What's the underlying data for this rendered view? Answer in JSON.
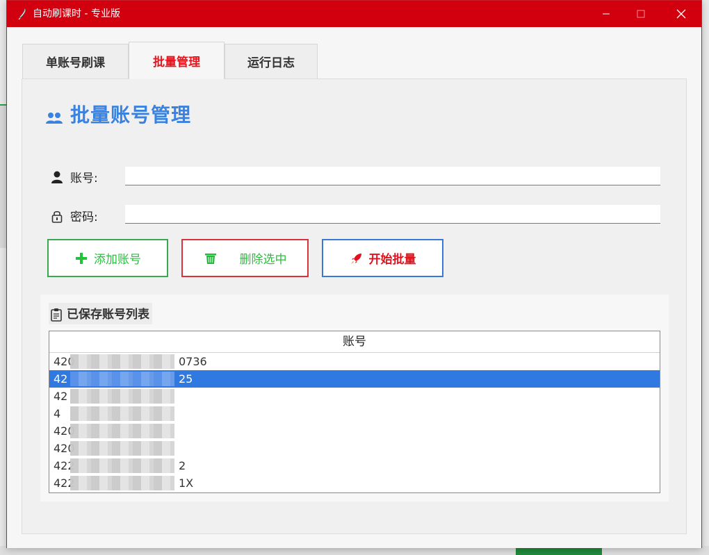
{
  "window": {
    "title": "自动刷课时 - 专业版"
  },
  "tabs": [
    {
      "label": "单账号刷课",
      "active": false
    },
    {
      "label": "批量管理",
      "active": true
    },
    {
      "label": "运行日志",
      "active": false
    }
  ],
  "section": {
    "title": "批量账号管理",
    "icon": "users-icon"
  },
  "form": {
    "account_label": "账号:",
    "account_value": "",
    "password_label": "密码:",
    "password_value": ""
  },
  "buttons": {
    "add": "添加账号",
    "delete": "删除选中",
    "start": "开始批量"
  },
  "list": {
    "label": "已保存账号列表",
    "column_header": "账号",
    "rows": [
      {
        "visible_start": "420",
        "visible_end": "0736",
        "selected": false
      },
      {
        "visible_start": "42",
        "visible_end": "25",
        "selected": true
      },
      {
        "visible_start": "42",
        "visible_end": "",
        "selected": false
      },
      {
        "visible_start": "4",
        "visible_end": "",
        "selected": false
      },
      {
        "visible_start": "420",
        "visible_end": "",
        "selected": false
      },
      {
        "visible_start": "420",
        "visible_end": "",
        "selected": false
      },
      {
        "visible_start": "422",
        "visible_end": "2",
        "selected": false
      },
      {
        "visible_start": "422",
        "visible_end": "1X",
        "selected": false
      }
    ]
  },
  "colors": {
    "titlebar": "#d2000f",
    "accent_blue": "#3a82e0",
    "active_tab_text": "#e8141e",
    "add_green": "#27c23f",
    "selection": "#3079e0"
  }
}
